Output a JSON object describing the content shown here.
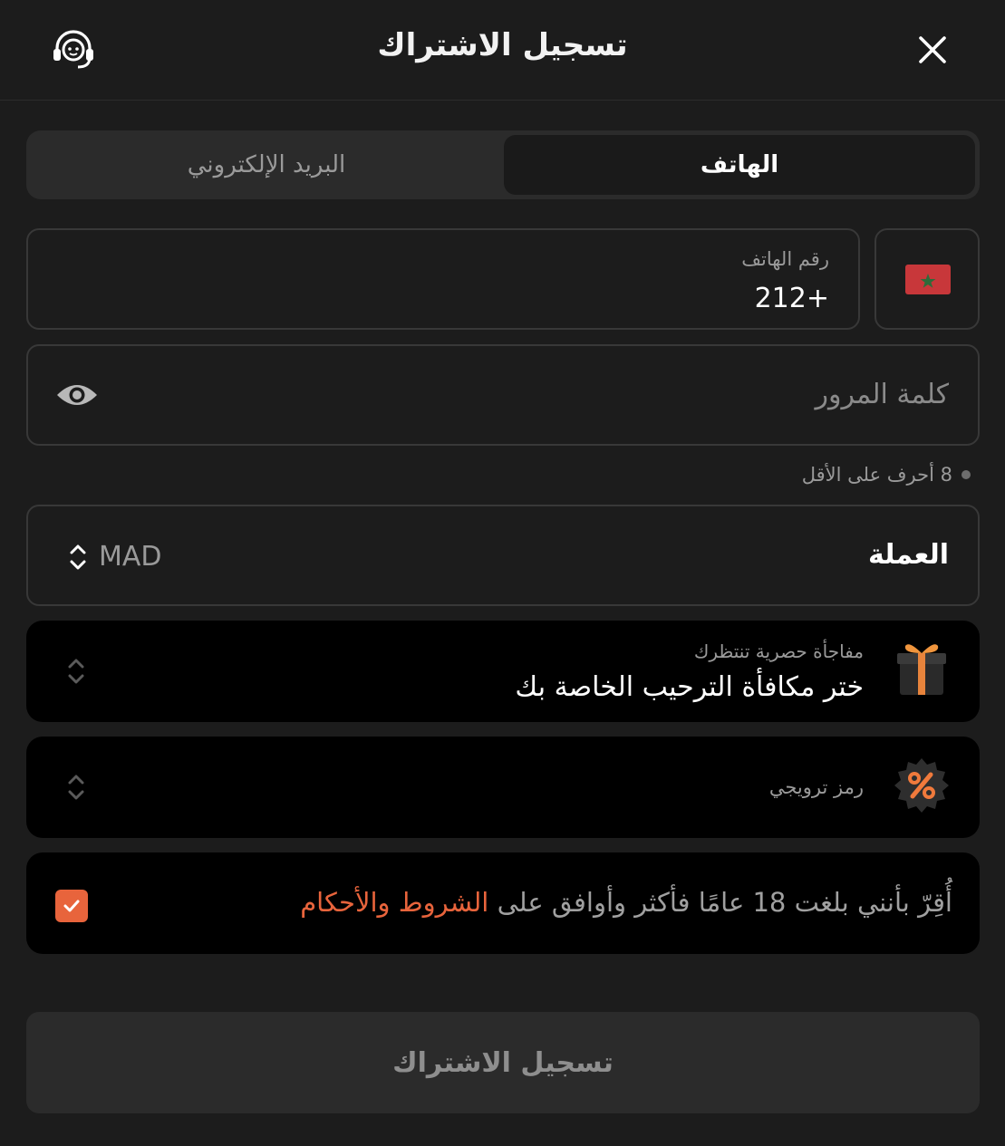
{
  "header": {
    "title": "تسجيل الاشتراك",
    "support_icon": "headset-icon",
    "close_icon": "close-icon"
  },
  "tabs": [
    {
      "label": "الهاتف",
      "active": true
    },
    {
      "label": "البريد الإلكتروني",
      "active": false
    }
  ],
  "phone": {
    "label": "رقم الهاتف",
    "value": "+212",
    "country_flag": "morocco-flag-icon"
  },
  "password": {
    "placeholder": "كلمة المرور",
    "toggle_icon": "eye-icon",
    "hint": "8 أحرف على الأقل"
  },
  "currency": {
    "label": "العملة",
    "value": "MAD"
  },
  "bonus": {
    "subtitle": "مفاجأة حصرية تنتظرك",
    "title": "ختر مكافأة الترحيب الخاصة بك",
    "icon": "gift-icon"
  },
  "promo": {
    "label": "رمز ترويجي",
    "icon": "percent-badge-icon"
  },
  "terms": {
    "text": "أُقِرّ بأنني بلغت 18 عامًا فأكثر وأوافق على ",
    "link": "الشروط والأحكام",
    "checked": true
  },
  "submit": {
    "label": "تسجيل الاشتراك"
  },
  "colors": {
    "accent": "#e8643c",
    "background": "#1c1c1c",
    "card": "#000000",
    "field_border": "#383838"
  }
}
